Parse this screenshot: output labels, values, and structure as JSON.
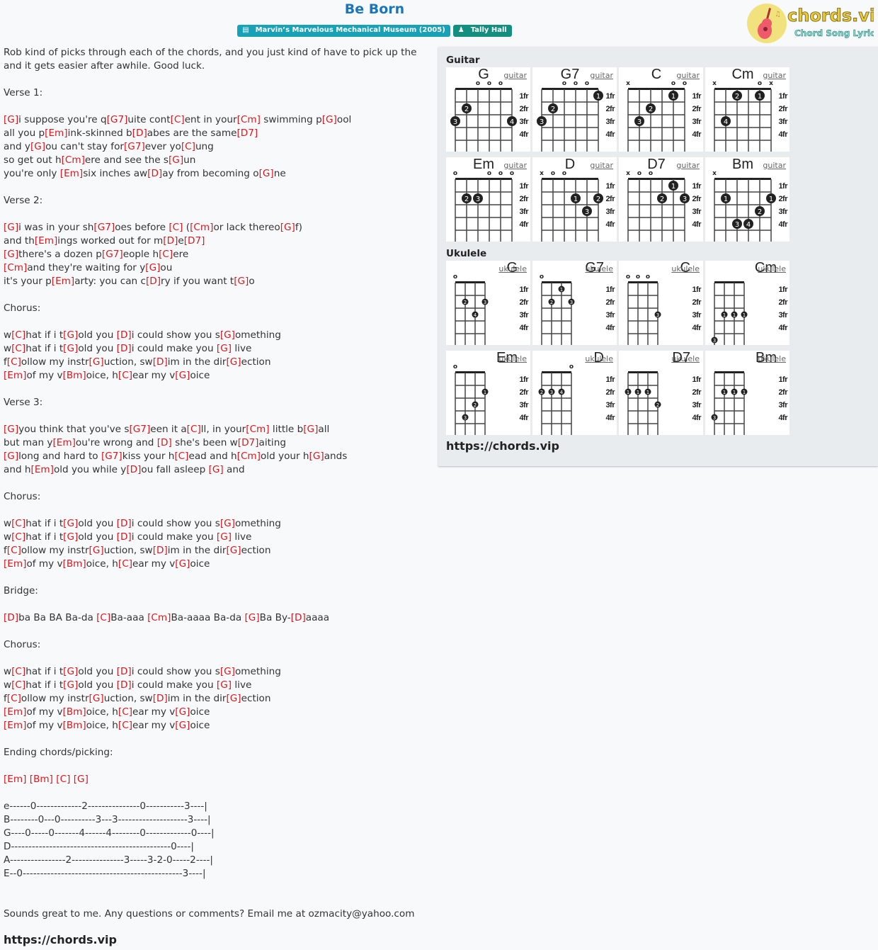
{
  "header": {
    "title": "Be Born",
    "album_badge": "Marvin’s Marvelous Mechanical Museum (2005)",
    "artist_badge": "Tally Hall",
    "album_icon": "book-icon",
    "artist_icon": "user-icon"
  },
  "logo": {
    "brand": "chords.vip",
    "tagline": "Chord Song Lyric"
  },
  "lyrics": [
    [
      {
        "t": "Rob kind of picks through each of the chords, and you just kind of have to pick up the"
      }
    ],
    [
      {
        "t": "and it gets easier after awhile. Good luck."
      }
    ],
    [],
    [
      {
        "t": "Verse 1:"
      }
    ],
    [],
    [
      {
        "c": "[G]"
      },
      {
        "t": "i suppose you're q"
      },
      {
        "c": "[G7]"
      },
      {
        "t": "uite cont"
      },
      {
        "c": "[C]"
      },
      {
        "t": "ent in your"
      },
      {
        "c": "[Cm]"
      },
      {
        "t": " swimming p"
      },
      {
        "c": "[G]"
      },
      {
        "t": "ool"
      }
    ],
    [
      {
        "t": "all you p"
      },
      {
        "c": "[Em]"
      },
      {
        "t": "ink-skinned b"
      },
      {
        "c": "[D]"
      },
      {
        "t": "abes are the same"
      },
      {
        "c": "[D7]"
      }
    ],
    [
      {
        "t": "and y"
      },
      {
        "c": "[G]"
      },
      {
        "t": "ou can't stay for"
      },
      {
        "c": "[G7]"
      },
      {
        "t": "ever yo"
      },
      {
        "c": "[C]"
      },
      {
        "t": "ung"
      }
    ],
    [
      {
        "t": "so get out h"
      },
      {
        "c": "[Cm]"
      },
      {
        "t": "ere and see the s"
      },
      {
        "c": "[G]"
      },
      {
        "t": "un"
      }
    ],
    [
      {
        "t": "you're only "
      },
      {
        "c": "[Em]"
      },
      {
        "t": "six inches aw"
      },
      {
        "c": "[D]"
      },
      {
        "t": "ay from becoming o"
      },
      {
        "c": "[G]"
      },
      {
        "t": "ne"
      }
    ],
    [],
    [
      {
        "t": "Verse 2:"
      }
    ],
    [],
    [
      {
        "c": "[G]"
      },
      {
        "t": "i was in your sh"
      },
      {
        "c": "[G7]"
      },
      {
        "t": "oes before "
      },
      {
        "c": "[C]"
      },
      {
        "t": " ("
      },
      {
        "c": "[Cm]"
      },
      {
        "t": "or lack thereo"
      },
      {
        "c": "[G]"
      },
      {
        "t": "f)"
      }
    ],
    [
      {
        "t": "and th"
      },
      {
        "c": "[Em]"
      },
      {
        "t": "ings worked out for m"
      },
      {
        "c": "[D]"
      },
      {
        "t": "e"
      },
      {
        "c": "[D7]"
      }
    ],
    [
      {
        "c": "[G]"
      },
      {
        "t": "there's a dozen p"
      },
      {
        "c": "[G7]"
      },
      {
        "t": "eople h"
      },
      {
        "c": "[C]"
      },
      {
        "t": "ere"
      }
    ],
    [
      {
        "c": "[Cm]"
      },
      {
        "t": "and they're waiting for y"
      },
      {
        "c": "[G]"
      },
      {
        "t": "ou"
      }
    ],
    [
      {
        "t": "it's your p"
      },
      {
        "c": "[Em]"
      },
      {
        "t": "arty: you can c"
      },
      {
        "c": "[D]"
      },
      {
        "t": "ry if you want t"
      },
      {
        "c": "[G]"
      },
      {
        "t": "o"
      }
    ],
    [],
    [
      {
        "t": "Chorus:"
      }
    ],
    [],
    [
      {
        "t": "w"
      },
      {
        "c": "[C]"
      },
      {
        "t": "hat if i t"
      },
      {
        "c": "[G]"
      },
      {
        "t": "old you "
      },
      {
        "c": "[D]"
      },
      {
        "t": "i could show you s"
      },
      {
        "c": "[G]"
      },
      {
        "t": "omething"
      }
    ],
    [
      {
        "t": "w"
      },
      {
        "c": "[C]"
      },
      {
        "t": "hat if i t"
      },
      {
        "c": "[G]"
      },
      {
        "t": "old you "
      },
      {
        "c": "[D]"
      },
      {
        "t": "i could make you "
      },
      {
        "c": "[G]"
      },
      {
        "t": " live"
      }
    ],
    [
      {
        "t": "f"
      },
      {
        "c": "[C]"
      },
      {
        "t": "ollow my instr"
      },
      {
        "c": "[G]"
      },
      {
        "t": "uction, sw"
      },
      {
        "c": "[D]"
      },
      {
        "t": "im in the dir"
      },
      {
        "c": "[G]"
      },
      {
        "t": "ection"
      }
    ],
    [
      {
        "c": "[Em]"
      },
      {
        "t": "of my v"
      },
      {
        "c": "[Bm]"
      },
      {
        "t": "oice, h"
      },
      {
        "c": "[C]"
      },
      {
        "t": "ear my v"
      },
      {
        "c": "[G]"
      },
      {
        "t": "oice"
      }
    ],
    [],
    [
      {
        "t": "Verse 3:"
      }
    ],
    [],
    [
      {
        "c": "[G]"
      },
      {
        "t": "you think that you've s"
      },
      {
        "c": "[G7]"
      },
      {
        "t": "een it a"
      },
      {
        "c": "[C]"
      },
      {
        "t": "ll, in your"
      },
      {
        "c": "[Cm]"
      },
      {
        "t": " little b"
      },
      {
        "c": "[G]"
      },
      {
        "t": "all"
      }
    ],
    [
      {
        "t": "but man y"
      },
      {
        "c": "[Em]"
      },
      {
        "t": "ou're wrong and "
      },
      {
        "c": "[D]"
      },
      {
        "t": " she's been w"
      },
      {
        "c": "[D7]"
      },
      {
        "t": "aiting"
      }
    ],
    [
      {
        "c": "[G]"
      },
      {
        "t": "long and hard to "
      },
      {
        "c": "[G7]"
      },
      {
        "t": "kiss your h"
      },
      {
        "c": "[C]"
      },
      {
        "t": "ead and h"
      },
      {
        "c": "[Cm]"
      },
      {
        "t": "old your h"
      },
      {
        "c": "[G]"
      },
      {
        "t": "ands"
      }
    ],
    [
      {
        "t": "and h"
      },
      {
        "c": "[Em]"
      },
      {
        "t": "old you while y"
      },
      {
        "c": "[D]"
      },
      {
        "t": "ou fall asleep "
      },
      {
        "c": "[G]"
      },
      {
        "t": " and"
      }
    ],
    [],
    [
      {
        "t": "Chorus:"
      }
    ],
    [],
    [
      {
        "t": "w"
      },
      {
        "c": "[C]"
      },
      {
        "t": "hat if i t"
      },
      {
        "c": "[G]"
      },
      {
        "t": "old you "
      },
      {
        "c": "[D]"
      },
      {
        "t": "i could show you s"
      },
      {
        "c": "[G]"
      },
      {
        "t": "omething"
      }
    ],
    [
      {
        "t": "w"
      },
      {
        "c": "[C]"
      },
      {
        "t": "hat if i t"
      },
      {
        "c": "[G]"
      },
      {
        "t": "old you "
      },
      {
        "c": "[D]"
      },
      {
        "t": "i could make you "
      },
      {
        "c": "[G]"
      },
      {
        "t": " live"
      }
    ],
    [
      {
        "t": "f"
      },
      {
        "c": "[C]"
      },
      {
        "t": "ollow my instr"
      },
      {
        "c": "[G]"
      },
      {
        "t": "uction, sw"
      },
      {
        "c": "[D]"
      },
      {
        "t": "im in the dir"
      },
      {
        "c": "[G]"
      },
      {
        "t": "ection"
      }
    ],
    [
      {
        "c": "[Em]"
      },
      {
        "t": "of my v"
      },
      {
        "c": "[Bm]"
      },
      {
        "t": "oice, h"
      },
      {
        "c": "[C]"
      },
      {
        "t": "ear my v"
      },
      {
        "c": "[G]"
      },
      {
        "t": "oice"
      }
    ],
    [],
    [
      {
        "t": "Bridge:"
      }
    ],
    [],
    [
      {
        "c": "[D]"
      },
      {
        "t": "ba Ba BA Ba-da "
      },
      {
        "c": "[C]"
      },
      {
        "t": "Ba-aaa "
      },
      {
        "c": "[Cm]"
      },
      {
        "t": "Ba-aaaa Ba-da "
      },
      {
        "c": "[G]"
      },
      {
        "t": "Ba By-"
      },
      {
        "c": "[D]"
      },
      {
        "t": "aaaa"
      }
    ],
    [],
    [
      {
        "t": "Chorus:"
      }
    ],
    [],
    [
      {
        "t": "w"
      },
      {
        "c": "[C]"
      },
      {
        "t": "hat if i t"
      },
      {
        "c": "[G]"
      },
      {
        "t": "old you "
      },
      {
        "c": "[D]"
      },
      {
        "t": "i could show you s"
      },
      {
        "c": "[G]"
      },
      {
        "t": "omething"
      }
    ],
    [
      {
        "t": "w"
      },
      {
        "c": "[C]"
      },
      {
        "t": "hat if i t"
      },
      {
        "c": "[G]"
      },
      {
        "t": "old you "
      },
      {
        "c": "[D]"
      },
      {
        "t": "i could make you "
      },
      {
        "c": "[G]"
      },
      {
        "t": " live"
      }
    ],
    [
      {
        "t": "f"
      },
      {
        "c": "[C]"
      },
      {
        "t": "ollow my instr"
      },
      {
        "c": "[G]"
      },
      {
        "t": "uction, sw"
      },
      {
        "c": "[D]"
      },
      {
        "t": "im in the dir"
      },
      {
        "c": "[G]"
      },
      {
        "t": "ection"
      }
    ],
    [
      {
        "c": "[Em]"
      },
      {
        "t": "of my v"
      },
      {
        "c": "[Bm]"
      },
      {
        "t": "oice, h"
      },
      {
        "c": "[C]"
      },
      {
        "t": "ear my v"
      },
      {
        "c": "[G]"
      },
      {
        "t": "oice"
      }
    ],
    [
      {
        "c": "[Em]"
      },
      {
        "t": "of my v"
      },
      {
        "c": "[Bm]"
      },
      {
        "t": "oice, h"
      },
      {
        "c": "[C]"
      },
      {
        "t": "ear my v"
      },
      {
        "c": "[G]"
      },
      {
        "t": "oice"
      }
    ],
    [],
    [
      {
        "t": "Ending chords/picking:"
      }
    ],
    [],
    [
      {
        "c": "[Em]"
      },
      {
        "t": " "
      },
      {
        "c": "[Bm]"
      },
      {
        "t": " "
      },
      {
        "c": "[C]"
      },
      {
        "t": " "
      },
      {
        "c": "[G]"
      }
    ],
    [],
    [
      {
        "t": "e------0-------------2---------------0-----------3----|"
      }
    ],
    [
      {
        "t": "B--------0---0----------3---3--------------------3----|"
      }
    ],
    [
      {
        "t": "G----0-----0-------4------4--------0-------------0----|"
      }
    ],
    [
      {
        "t": "D----------------------------------------------0----|"
      }
    ],
    [
      {
        "t": "A----------------2---------------3-----3-2-0-----2----|"
      }
    ],
    [
      {
        "t": "E--0----------------------------------------------3----|"
      }
    ],
    [],
    [],
    [
      {
        "t": "Sounds great to me. Any questions or comments? Email me at ozmacity@yahoo.com"
      }
    ]
  ],
  "footer": {
    "url": "https://chords.vip"
  },
  "chords_panel": {
    "guitar_heading": "Guitar",
    "ukulele_heading": "Ukulele",
    "url": "https://chords.vip",
    "fret_labels": [
      "1fr",
      "2fr",
      "3fr",
      "4fr"
    ],
    "guitar": [
      {
        "name": "G",
        "link": "guitar",
        "top": [
          "",
          "",
          "o",
          "o",
          "o",
          ""
        ],
        "dots": [
          [
            1,
            2,
            2
          ],
          [
            0,
            3,
            3
          ],
          [
            5,
            3,
            4
          ]
        ]
      },
      {
        "name": "G7",
        "link": "guitar",
        "top": [
          "",
          "",
          "o",
          "o",
          "o",
          ""
        ],
        "dots": [
          [
            5,
            1,
            1
          ],
          [
            1,
            2,
            2
          ],
          [
            0,
            3,
            3
          ]
        ]
      },
      {
        "name": "C",
        "link": "guitar",
        "top": [
          "x",
          "",
          "",
          "",
          "o",
          "o"
        ],
        "dots": [
          [
            4,
            1,
            1
          ],
          [
            2,
            2,
            2
          ],
          [
            1,
            3,
            3
          ]
        ]
      },
      {
        "name": "Cm",
        "link": "guitar",
        "top": [
          "x",
          "",
          "",
          "",
          "o",
          "x"
        ],
        "dots": [
          [
            2,
            1,
            2
          ],
          [
            4,
            1,
            1
          ],
          [
            1,
            3,
            4
          ]
        ]
      },
      {
        "name": "Em",
        "link": "guitar",
        "top": [
          "o",
          "",
          "",
          "o",
          "o",
          "o"
        ],
        "dots": [
          [
            1,
            2,
            2
          ],
          [
            2,
            2,
            3
          ]
        ]
      },
      {
        "name": "D",
        "link": "guitar",
        "top": [
          "x",
          "o",
          "o",
          "",
          "",
          ""
        ],
        "dots": [
          [
            3,
            2,
            1
          ],
          [
            5,
            2,
            2
          ],
          [
            4,
            3,
            3
          ]
        ]
      },
      {
        "name": "D7",
        "link": "guitar",
        "top": [
          "x",
          "o",
          "o",
          "",
          "",
          ""
        ],
        "dots": [
          [
            4,
            1,
            1
          ],
          [
            3,
            2,
            2
          ],
          [
            5,
            2,
            3
          ]
        ]
      },
      {
        "name": "Bm",
        "link": "guitar",
        "top": [
          "x",
          "",
          "",
          "",
          "",
          ""
        ],
        "dots": [
          [
            1,
            2,
            1
          ],
          [
            5,
            2,
            1
          ],
          [
            4,
            3,
            2
          ],
          [
            2,
            4,
            3
          ],
          [
            3,
            4,
            4
          ]
        ]
      }
    ],
    "ukulele": [
      {
        "name": "G",
        "link": "ukulele",
        "top": [
          "o",
          "",
          "",
          ""
        ],
        "dots": [
          [
            1,
            2,
            2
          ],
          [
            3,
            2,
            3
          ],
          [
            2,
            3,
            4
          ]
        ]
      },
      {
        "name": "G7",
        "link": "ukulele",
        "top": [
          "o",
          "",
          "",
          ""
        ],
        "dots": [
          [
            2,
            1,
            1
          ],
          [
            1,
            2,
            2
          ],
          [
            3,
            2,
            3
          ]
        ]
      },
      {
        "name": "C",
        "link": "ukulele",
        "top": [
          "o",
          "o",
          "o",
          ""
        ],
        "dots": [
          [
            3,
            3,
            3
          ]
        ]
      },
      {
        "name": "Cm",
        "link": "ukulele",
        "top": [
          "",
          "",
          "",
          ""
        ],
        "dots": [
          [
            1,
            3,
            1
          ],
          [
            2,
            3,
            1
          ],
          [
            3,
            3,
            1
          ],
          [
            0,
            5,
            3
          ]
        ]
      },
      {
        "name": "Em",
        "link": "ukulele",
        "top": [
          "o",
          "",
          "",
          ""
        ],
        "dots": [
          [
            3,
            2,
            1
          ],
          [
            2,
            3,
            2
          ],
          [
            1,
            4,
            3
          ]
        ]
      },
      {
        "name": "D",
        "link": "ukulele",
        "top": [
          "",
          "",
          "",
          "o"
        ],
        "dots": [
          [
            0,
            2,
            2
          ],
          [
            1,
            2,
            3
          ],
          [
            2,
            2,
            4
          ]
        ]
      },
      {
        "name": "D7",
        "link": "ukulele",
        "top": [
          "",
          "",
          "",
          ""
        ],
        "dots": [
          [
            0,
            2,
            1
          ],
          [
            1,
            2,
            1
          ],
          [
            2,
            2,
            1
          ],
          [
            3,
            3,
            2
          ]
        ]
      },
      {
        "name": "Bm",
        "link": "ukulele",
        "top": [
          "",
          "",
          "",
          ""
        ],
        "dots": [
          [
            1,
            2,
            1
          ],
          [
            2,
            2,
            1
          ],
          [
            3,
            2,
            1
          ],
          [
            0,
            4,
            3
          ]
        ]
      }
    ]
  },
  "colors": {
    "title": "#1b75bb",
    "chord": "#e0161c",
    "album_badge": "#17a2b8",
    "artist_badge": "#138f7f"
  }
}
